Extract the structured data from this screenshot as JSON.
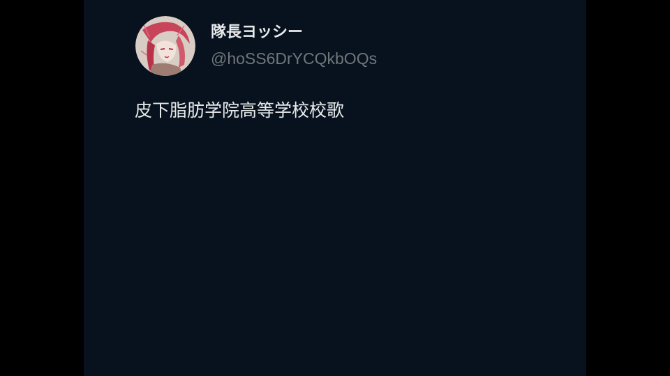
{
  "colors": {
    "letterbox": "#000000",
    "panel_background": "#07121e",
    "primary_text": "#e7e9ea",
    "secondary_text": "#71767b"
  },
  "author": {
    "display_name": "隊長ヨッシー",
    "handle": "@hoSS6DrYCQkbOQs",
    "avatar_icon": "anime-illustration-avatar"
  },
  "tweet": {
    "text": "皮下脂肪学院高等学校校歌"
  }
}
